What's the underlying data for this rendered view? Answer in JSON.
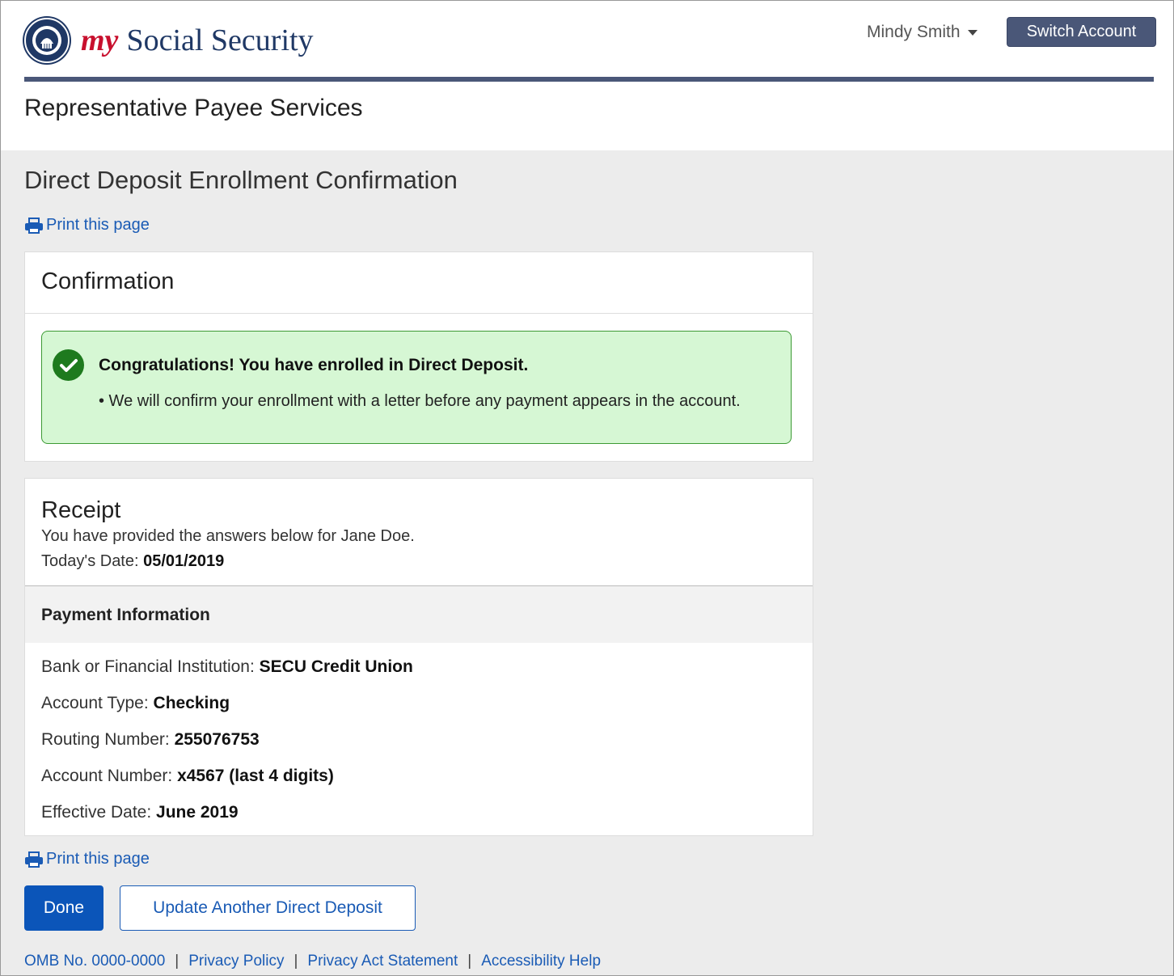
{
  "header": {
    "brand_my": "my",
    "brand_name": "Social Security",
    "user_name": "Mindy Smith",
    "switch_account": "Switch Account",
    "section_title": "Representative Payee Services"
  },
  "page": {
    "title": "Direct Deposit Enrollment Confirmation",
    "print_link": "Print this page"
  },
  "confirmation": {
    "heading": "Confirmation",
    "alert_title": "Congratulations! You have enrolled in Direct Deposit.",
    "alert_body": "• We will confirm your enrollment with a letter before any payment appears in the account."
  },
  "receipt": {
    "heading": "Receipt",
    "intro": "You have provided the answers below for Jane Doe.",
    "date_label": "Today's Date: ",
    "date_value": "05/01/2019",
    "payment_heading": "Payment Information",
    "rows": [
      {
        "label": "Bank or Financial Institution: ",
        "value": "SECU Credit Union"
      },
      {
        "label": "Account Type: ",
        "value": "Checking"
      },
      {
        "label": "Routing Number: ",
        "value": "255076753"
      },
      {
        "label": "Account Number: ",
        "value": "x4567 (last 4 digits)"
      },
      {
        "label": "Effective Date: ",
        "value": "June 2019"
      }
    ]
  },
  "actions": {
    "done": "Done",
    "update_another": "Update Another Direct Deposit"
  },
  "footer": {
    "omb": "OMB No. 0000-0000",
    "privacy_policy": "Privacy Policy",
    "privacy_act": "Privacy Act Statement",
    "accessibility": "Accessibility Help",
    "separator": "|"
  },
  "colors": {
    "brand_navy": "#1f3865",
    "brand_red": "#c8102e",
    "link_blue": "#1a5bb5",
    "button_blue": "#0b55b9",
    "success_bg": "#d6f7d4",
    "success_border": "#3c9a34"
  },
  "icons": {
    "seal": "ssa-seal-icon",
    "print": "printer-icon",
    "success": "check-circle-icon",
    "dropdown": "caret-down-icon"
  }
}
